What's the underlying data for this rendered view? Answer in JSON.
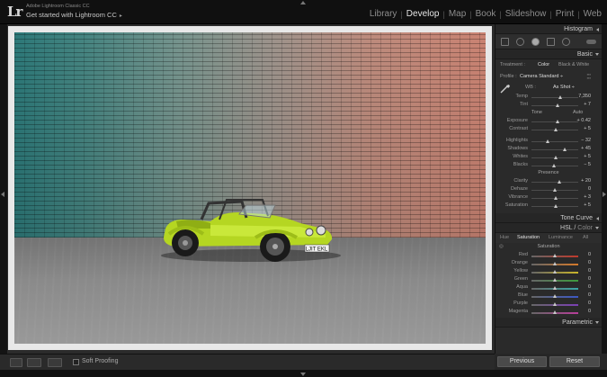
{
  "app": {
    "logo": "Lr",
    "name": "Adobe Lightroom Classic CC",
    "identity": "Get started with Lightroom CC",
    "identity_arrow": "▸"
  },
  "modules": [
    {
      "label": "Library",
      "active": false
    },
    {
      "label": "Develop",
      "active": true
    },
    {
      "label": "Map",
      "active": false
    },
    {
      "label": "Book",
      "active": false
    },
    {
      "label": "Slideshow",
      "active": false
    },
    {
      "label": "Print",
      "active": false
    },
    {
      "label": "Web",
      "active": false
    }
  ],
  "photo": {
    "plate": "LJIT EKL"
  },
  "filmstrip": {
    "soft_proofing_label": "Soft Proofing"
  },
  "panels": {
    "histogram": "Histogram",
    "basic": "Basic",
    "tone_curve": "Tone Curve",
    "hsl": "HSL",
    "hsl_sep": "/",
    "color": "Color",
    "parametric": "Parametric"
  },
  "basic": {
    "treatment_label": "Treatment :",
    "treatment_color": "Color",
    "treatment_bw": "Black & White",
    "profile_label": "Profile :",
    "profile_value": "Camera Standard",
    "profile_arrow": "÷",
    "wb_label": "WB :",
    "wb_value": "As Shot ÷",
    "tone_label": "Tone",
    "auto_label": "Auto",
    "presence_label": "Presence",
    "wb_sliders": [
      {
        "label": "Temp",
        "value": "7,350",
        "pos": 0.62
      },
      {
        "label": "Tint",
        "value": "+ 7",
        "pos": 0.55
      }
    ],
    "tone_sliders": [
      {
        "label": "Exposure",
        "value": "+ 0.42",
        "pos": 0.55
      },
      {
        "label": "Contrast",
        "value": "+ 5",
        "pos": 0.52
      }
    ],
    "tone_sliders2": [
      {
        "label": "Highlights",
        "value": "− 32",
        "pos": 0.34
      },
      {
        "label": "Shadows",
        "value": "+ 45",
        "pos": 0.72
      },
      {
        "label": "Whites",
        "value": "+ 5",
        "pos": 0.52
      },
      {
        "label": "Blacks",
        "value": "− 5",
        "pos": 0.48
      }
    ],
    "presence_sliders": [
      {
        "label": "Clarity",
        "value": "+ 20",
        "pos": 0.6
      },
      {
        "label": "Dehaze",
        "value": "0",
        "pos": 0.5
      },
      {
        "label": "Vibrance",
        "value": "+ 3",
        "pos": 0.51
      },
      {
        "label": "Saturation",
        "value": "+ 5",
        "pos": 0.52
      }
    ]
  },
  "hsl": {
    "tabs": [
      "Hue",
      "Saturation",
      "Luminance",
      "All"
    ],
    "active_tab": "Saturation",
    "section": "Saturation",
    "target_icon": "target-adjustment-icon",
    "colors": [
      {
        "label": "Red",
        "value": "0",
        "c": "#c0392b"
      },
      {
        "label": "Orange",
        "value": "0",
        "c": "#d67a2a"
      },
      {
        "label": "Yellow",
        "value": "0",
        "c": "#c9b52a"
      },
      {
        "label": "Green",
        "value": "0",
        "c": "#3d9a3d"
      },
      {
        "label": "Aqua",
        "value": "0",
        "c": "#3aa6a6"
      },
      {
        "label": "Blue",
        "value": "0",
        "c": "#3b58c4"
      },
      {
        "label": "Purple",
        "value": "0",
        "c": "#7b3fb5"
      },
      {
        "label": "Magenta",
        "value": "0",
        "c": "#b83e9a"
      }
    ]
  },
  "buttons": {
    "previous": "Previous",
    "reset": "Reset"
  },
  "colors": {
    "accent": "#e6e6e6",
    "panel_bg": "#2a2a2a",
    "car_body": "#b5d622"
  }
}
